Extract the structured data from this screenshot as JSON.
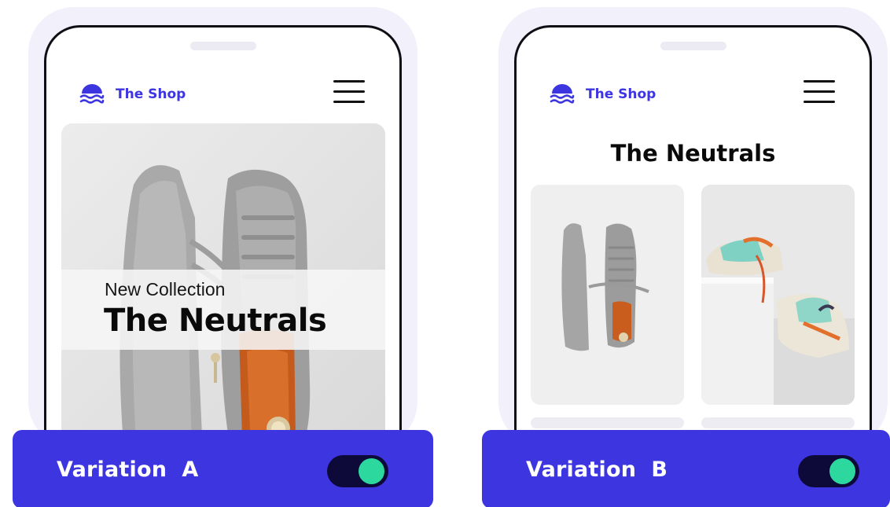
{
  "colors": {
    "accent": "#3d36e0",
    "toggle_track": "#0d0a3a",
    "toggle_knob": "#2dd89f",
    "frame": "#f1f0fb"
  },
  "variation_a": {
    "brand": {
      "name": "The Shop",
      "icon": "waves-logo-icon"
    },
    "menu_icon": "hamburger-menu-icon",
    "hero": {
      "subtitle": "New Collection",
      "title": "The Neutrals",
      "image": "grey-sneakers-photo"
    },
    "bar": {
      "label": "Variation  A",
      "toggle_on": true
    }
  },
  "variation_b": {
    "brand": {
      "name": "The Shop",
      "icon": "waves-logo-icon"
    },
    "menu_icon": "hamburger-menu-icon",
    "title": "The Neutrals",
    "cards": [
      {
        "image": "grey-sneakers-photo"
      },
      {
        "image": "colorful-sneakers-photo"
      }
    ],
    "bar": {
      "label": "Variation  B",
      "toggle_on": true
    }
  }
}
